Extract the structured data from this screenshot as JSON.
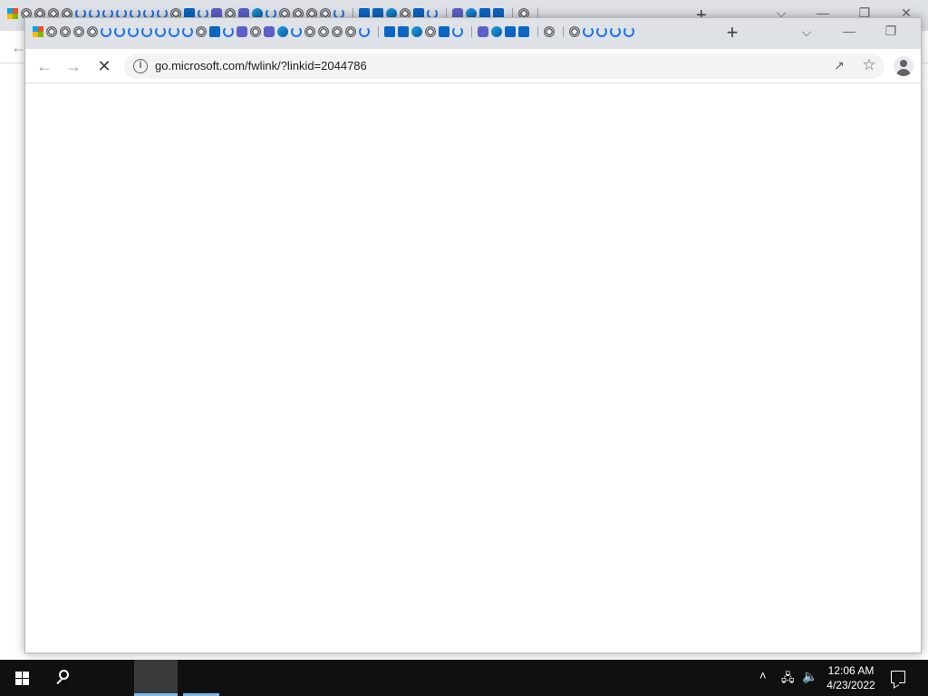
{
  "background_window": {
    "back_icon": "arrow-left-icon",
    "tabs_icons": [
      "chrome-icon",
      "ms-icon",
      "linkedin-icon",
      "edge-icon"
    ]
  },
  "browser": {
    "tab_strip": {
      "new_tab_label": "+",
      "favicon_sequence": [
        "ms",
        "chrome",
        "chrome",
        "chrome",
        "chrome",
        "loading",
        "loading",
        "loading",
        "loading",
        "loading",
        "loading",
        "loading",
        "chrome",
        "li",
        "loading",
        "teams",
        "chrome",
        "teams",
        "edge",
        "loading",
        "chrome",
        "chrome",
        "chrome",
        "chrome",
        "loading",
        "sep",
        "li",
        "li",
        "edge",
        "chrome",
        "li",
        "loading",
        "sep",
        "teams",
        "edge",
        "li",
        "li",
        "sep",
        "chrome",
        "sep",
        "chrome",
        "loading",
        "loading",
        "loading",
        "loading"
      ]
    },
    "toolbar": {
      "url": "go.microsoft.com/fwlink/?linkid=2044786",
      "back_icon": "←",
      "forward_icon": "→",
      "stop_icon": "✕",
      "info_glyph": "i",
      "share_icon": "↗",
      "star_icon": "☆"
    },
    "caption": {
      "tab_search_icon": "⌵",
      "minimize_icon": "—",
      "restore_icon": "❐"
    }
  },
  "taskbar": {
    "clock_time": "12:06 AM",
    "clock_date": "4/23/2022",
    "tray_chevron": "˄",
    "network_icon": "🖧",
    "volume_icon": "🔈",
    "colors": {
      "taskbar_bg": "#101010",
      "active_underline": "#76b9ed"
    }
  }
}
